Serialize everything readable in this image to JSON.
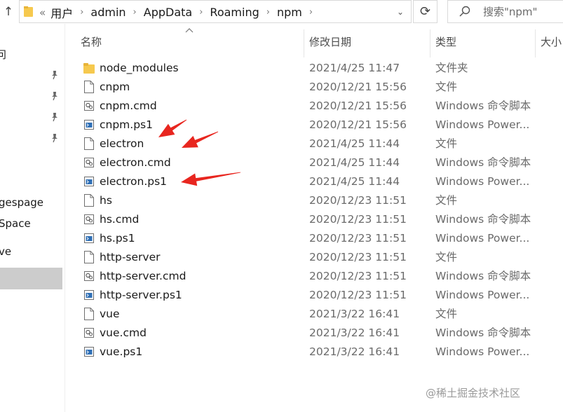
{
  "address_bar": {
    "overflow_glyph": "«",
    "path": [
      "用户",
      "admin",
      "AppData",
      "Roaming",
      "npm"
    ],
    "separator": "›"
  },
  "search": {
    "placeholder": "搜索\"npm\""
  },
  "nav_pane": {
    "items": [
      {
        "label": "问",
        "pinned": false
      },
      {
        "label": "gespage",
        "pinned": false
      },
      {
        "label": "Space",
        "pinned": false
      },
      {
        "label": "ve",
        "pinned": false
      }
    ],
    "pinned_count": 4
  },
  "columns": {
    "name": "名称",
    "date": "修改日期",
    "type": "类型",
    "size": "大小"
  },
  "files": [
    {
      "name": "node_modules",
      "date": "2021/4/25 11:47",
      "type": "文件夹",
      "icon": "folder-icon"
    },
    {
      "name": "cnpm",
      "date": "2020/12/21 15:56",
      "type": "文件",
      "icon": "file-icon"
    },
    {
      "name": "cnpm.cmd",
      "date": "2020/12/21 15:56",
      "type": "Windows 命令脚本",
      "icon": "cmd-script-icon"
    },
    {
      "name": "cnpm.ps1",
      "date": "2020/12/21 15:56",
      "type": "Windows Power...",
      "icon": "powershell-script-icon"
    },
    {
      "name": "electron",
      "date": "2021/4/25 11:44",
      "type": "文件",
      "icon": "file-icon"
    },
    {
      "name": "electron.cmd",
      "date": "2021/4/25 11:44",
      "type": "Windows 命令脚本",
      "icon": "cmd-script-icon"
    },
    {
      "name": "electron.ps1",
      "date": "2021/4/25 11:44",
      "type": "Windows Power...",
      "icon": "powershell-script-icon"
    },
    {
      "name": "hs",
      "date": "2020/12/23 11:51",
      "type": "文件",
      "icon": "file-icon"
    },
    {
      "name": "hs.cmd",
      "date": "2020/12/23 11:51",
      "type": "Windows 命令脚本",
      "icon": "cmd-script-icon"
    },
    {
      "name": "hs.ps1",
      "date": "2020/12/23 11:51",
      "type": "Windows Power...",
      "icon": "powershell-script-icon"
    },
    {
      "name": "http-server",
      "date": "2020/12/23 11:51",
      "type": "文件",
      "icon": "file-icon"
    },
    {
      "name": "http-server.cmd",
      "date": "2020/12/23 11:51",
      "type": "Windows 命令脚本",
      "icon": "cmd-script-icon"
    },
    {
      "name": "http-server.ps1",
      "date": "2020/12/23 11:51",
      "type": "Windows Power...",
      "icon": "powershell-script-icon"
    },
    {
      "name": "vue",
      "date": "2021/3/22 16:41",
      "type": "文件",
      "icon": "file-icon"
    },
    {
      "name": "vue.cmd",
      "date": "2021/3/22 16:41",
      "type": "Windows 命令脚本",
      "icon": "cmd-script-icon"
    },
    {
      "name": "vue.ps1",
      "date": "2021/3/22 16:41",
      "type": "Windows Power...",
      "icon": "powershell-script-icon"
    }
  ],
  "annotations": {
    "arrow_color": "#e8261f",
    "arrow_targets": [
      "electron",
      "electron",
      "electron.ps1"
    ]
  },
  "watermark": "@稀土掘金技术社区",
  "colors": {
    "selected_nav_bg": "#cccccc",
    "folder_yellow": "#f6c94e",
    "border": "#d9d9d9"
  }
}
